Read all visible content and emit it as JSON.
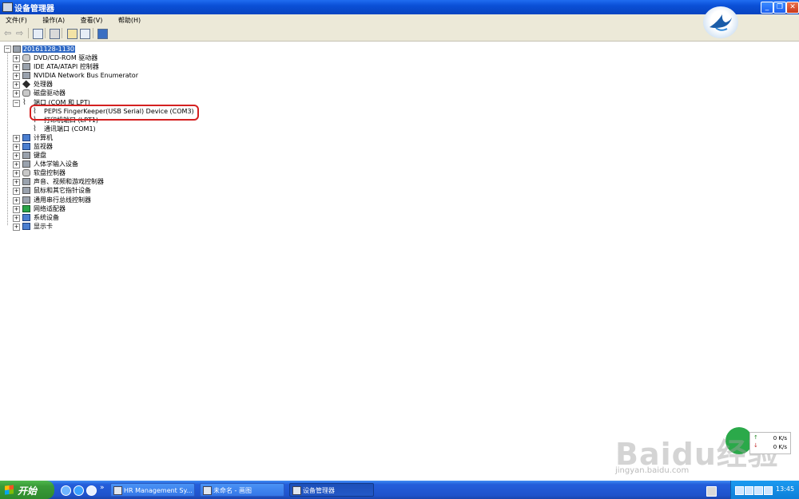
{
  "window": {
    "title": "设备管理器"
  },
  "menu": [
    "文件(F)",
    "操作(A)",
    "查看(V)",
    "帮助(H)"
  ],
  "toolbar_buttons": [
    "back-icon",
    "forward-icon",
    "properties-icon",
    "print-icon",
    "update-driver-icon",
    "scan-hardware-icon",
    "help-icon"
  ],
  "tree": {
    "root": "20161128-1130",
    "items": [
      {
        "id": "dvd",
        "label": "DVD/CD-ROM 驱动器",
        "icon": "dvd-drive-icon",
        "expanded": false
      },
      {
        "id": "ide",
        "label": "IDE ATA/ATAPI 控制器",
        "icon": "ide-controller-icon",
        "expanded": false
      },
      {
        "id": "nvidia",
        "label": "NVIDIA Network Bus Enumerator",
        "icon": "network-bus-icon",
        "expanded": false
      },
      {
        "id": "cpu",
        "label": "处理器",
        "icon": "processor-icon",
        "expanded": false
      },
      {
        "id": "disk",
        "label": "磁盘驱动器",
        "icon": "disk-drive-icon",
        "expanded": false
      },
      {
        "id": "ports",
        "label": "端口 (COM 和 LPT)",
        "icon": "port-icon",
        "expanded": true,
        "children": [
          {
            "id": "pepis",
            "label": "PEPIS FingerKeeper(USB Serial) Device (COM3)",
            "icon": "port-icon"
          },
          {
            "id": "lpt1",
            "label": "打印机端口 (LPT1)",
            "icon": "port-icon"
          },
          {
            "id": "com1",
            "label": "通讯端口 (COM1)",
            "icon": "port-icon"
          }
        ]
      },
      {
        "id": "computer",
        "label": "计算机",
        "icon": "computer-icon",
        "expanded": false
      },
      {
        "id": "monitor",
        "label": "监视器",
        "icon": "monitor-icon",
        "expanded": false
      },
      {
        "id": "keyboard",
        "label": "键盘",
        "icon": "keyboard-icon",
        "expanded": false
      },
      {
        "id": "hid",
        "label": "人体学输入设备",
        "icon": "hid-icon",
        "expanded": false
      },
      {
        "id": "floppy",
        "label": "软盘控制器",
        "icon": "floppy-controller-icon",
        "expanded": false
      },
      {
        "id": "sound",
        "label": "声音、视频和游戏控制器",
        "icon": "sound-icon",
        "expanded": false
      },
      {
        "id": "mouse",
        "label": "鼠标和其它指针设备",
        "icon": "mouse-icon",
        "expanded": false
      },
      {
        "id": "usb",
        "label": "通用串行总线控制器",
        "icon": "usb-icon",
        "expanded": false
      },
      {
        "id": "net",
        "label": "网络适配器",
        "icon": "network-adapter-icon",
        "expanded": false
      },
      {
        "id": "system",
        "label": "系统设备",
        "icon": "system-device-icon",
        "expanded": false
      },
      {
        "id": "display",
        "label": "显示卡",
        "icon": "display-adapter-icon",
        "expanded": false
      }
    ]
  },
  "watermark": {
    "text": "Baidu经验",
    "url": "jingyan.baidu.com"
  },
  "netspeed": {
    "up": "0 K/s",
    "down": "0 K/s"
  },
  "taskbar": {
    "start": "开始",
    "tasks": [
      {
        "label": "HR Management Sy...",
        "active": false
      },
      {
        "label": "未命名 - 画图",
        "active": false
      },
      {
        "label": "设备管理器",
        "active": true
      }
    ],
    "clock": "13:45"
  }
}
